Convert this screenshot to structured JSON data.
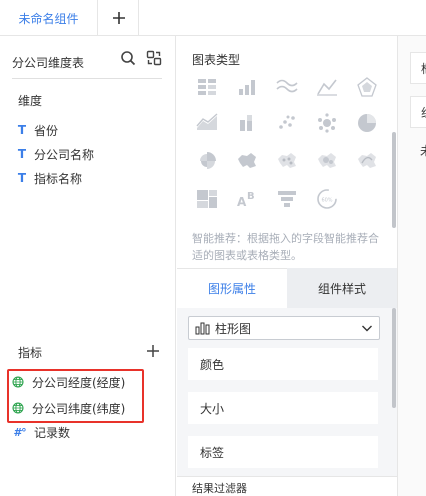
{
  "tabs": {
    "active_label": "未命名组件",
    "add_icon": "plus-icon"
  },
  "left_panel": {
    "dataset_title": "分公司维度表",
    "search_icon": "search-icon",
    "switch_icon": "switch-dataset-icon",
    "dimensions_label": "维度",
    "dimensions": [
      {
        "label": "省份",
        "type": "text"
      },
      {
        "label": "分公司名称",
        "type": "text"
      },
      {
        "label": "指标名称",
        "type": "text"
      }
    ],
    "metrics_label": "指标",
    "metrics": [
      {
        "label": "分公司经度(经度)",
        "type": "geo"
      },
      {
        "label": "分公司纬度(纬度)",
        "type": "geo"
      },
      {
        "label": "记录数",
        "type": "number"
      }
    ],
    "highlight_color": "#e8322a"
  },
  "middle_panel": {
    "chart_types_title": "图表类型",
    "smart_tip": "智能推荐：根据拖入的字段智能推荐合适的图表或表格类型。",
    "prop_tab_active": "图形属性",
    "prop_tab_other": "组件样式",
    "chart_select_value": "柱形图",
    "props": [
      "颜色",
      "大小",
      "标签"
    ],
    "result_filter": "结果过滤器",
    "accent_color": "#3c7fe8"
  },
  "right_panel": {
    "texts": [
      "框",
      "组",
      "未"
    ]
  }
}
